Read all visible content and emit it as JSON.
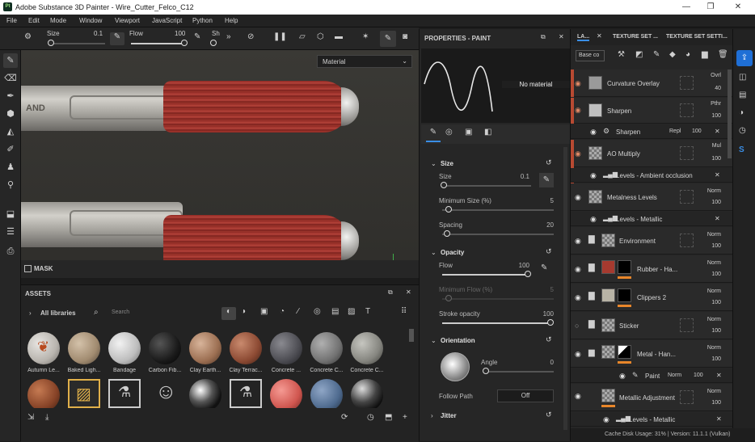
{
  "app": {
    "title": "Adobe Substance 3D Painter - Wire_Cutter_Felco_C12",
    "logo": "Pt"
  },
  "menu": [
    "File",
    "Edit",
    "Mode",
    "Window",
    "Viewport",
    "JavaScript",
    "Python",
    "Help"
  ],
  "toolbar": {
    "size_label": "Size",
    "size_value": "0.1",
    "flow_label": "Flow",
    "flow_value": "100",
    "sh_label": "Sh"
  },
  "viewport": {
    "dropdown": "Material",
    "mask_label": "MASK",
    "handle_text": "AND"
  },
  "assets": {
    "title": "ASSETS",
    "all_libraries": "All libraries",
    "search_placeholder": "Search",
    "row1": [
      "Autumn Le...",
      "Baked Ligh...",
      "Bandage",
      "Carbon Fib...",
      "Clay Earth...",
      "Clay Terrac...",
      "Concrete ...",
      "Concrete C...",
      "Concrete C..."
    ]
  },
  "properties": {
    "title": "PROPERTIES - PAINT",
    "preview": "No material",
    "size_section": "Size",
    "size_label": "Size",
    "size_value": "0.1",
    "min_size_label": "Minimum Size (%)",
    "min_size_value": "5",
    "spacing_label": "Spacing",
    "spacing_value": "20",
    "opacity_section": "Opacity",
    "flow_label": "Flow",
    "flow_value": "100",
    "min_flow_label": "Minimum Flow (%)",
    "min_flow_value": "5",
    "stroke_opacity_label": "Stroke opacity",
    "stroke_opacity_value": "100",
    "orientation_section": "Orientation",
    "angle_label": "Angle",
    "angle_value": "0",
    "follow_path_label": "Follow Path",
    "follow_path_value": "Off",
    "jitter_section": "Jitter"
  },
  "layers_panel": {
    "tabs": [
      "LA...",
      "TEXTURE SET ...",
      "TEXTURE SET SETTI..."
    ],
    "base_color": "Base co",
    "rows": [
      {
        "name": "Curvature Overlay",
        "blend": "Ovrl",
        "opacity": "40"
      },
      {
        "name": "Sharpen",
        "blend": "Pthr",
        "opacity": "100"
      },
      {
        "name": "Sharpen",
        "blend": "Repl",
        "opacity": "100",
        "sub": true
      },
      {
        "name": "AO Multiply",
        "blend": "Mul",
        "opacity": "100"
      },
      {
        "name": "Levels - Ambient occlusion",
        "sub": true
      },
      {
        "name": "Metalness Levels",
        "blend": "Norm",
        "opacity": "100"
      },
      {
        "name": "Levels - Metallic",
        "sub": true
      },
      {
        "name": "Environment",
        "blend": "Norm",
        "opacity": "100"
      },
      {
        "name": "Rubber - Ha...",
        "blend": "Norm",
        "opacity": "100"
      },
      {
        "name": "Clippers 2",
        "blend": "Norm",
        "opacity": "100"
      },
      {
        "name": "Sticker",
        "blend": "Norm",
        "opacity": "100"
      },
      {
        "name": "Metal - Han...",
        "blend": "Norm",
        "opacity": "100"
      },
      {
        "name": "Paint",
        "blend": "Norm",
        "opacity": "100",
        "sub": true
      },
      {
        "name": "Metallic Adjustment",
        "blend": "Norm",
        "opacity": "100"
      },
      {
        "name": "Levels - Metallic",
        "sub": true
      }
    ]
  },
  "status": {
    "text": "Cache Disk Usage:   31% | Version: 11.1.1 (Vulkan)"
  }
}
